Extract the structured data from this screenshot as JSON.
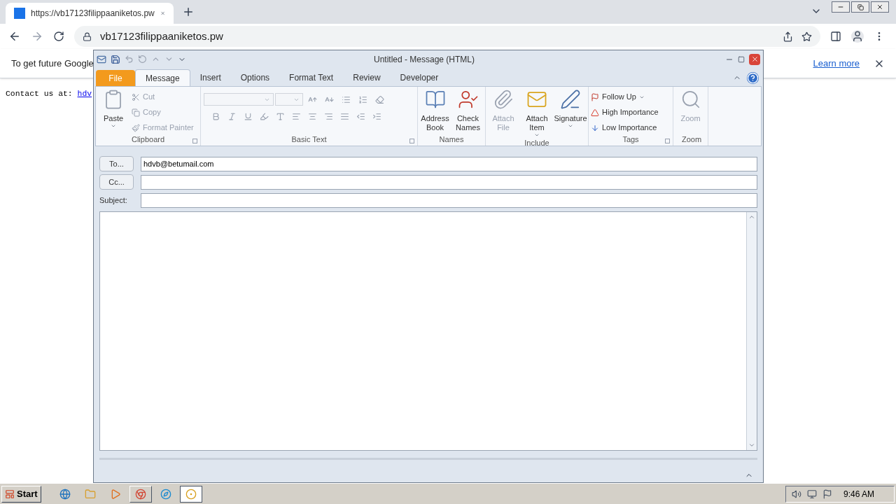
{
  "browser": {
    "tab": {
      "title": "https://vb17123filippaaniketos.pw"
    },
    "address": "vb17123filippaaniketos.pw",
    "infobar": {
      "text": "To get future Google",
      "link": "Learn more"
    }
  },
  "page": {
    "label": "Contact us at:",
    "link": "hdv"
  },
  "outlook": {
    "title": "Untitled - Message (HTML)",
    "tabs": [
      {
        "label": "File",
        "kind": "file",
        "selected": false
      },
      {
        "label": "Message",
        "kind": "tab",
        "selected": true
      },
      {
        "label": "Insert",
        "kind": "tab",
        "selected": false
      },
      {
        "label": "Options",
        "kind": "tab",
        "selected": false
      },
      {
        "label": "Format Text",
        "kind": "tab",
        "selected": false
      },
      {
        "label": "Review",
        "kind": "tab",
        "selected": false
      },
      {
        "label": "Developer",
        "kind": "tab",
        "selected": false
      }
    ],
    "groups": [
      {
        "label": "Clipboard",
        "kind": "clipboard",
        "launcher": true,
        "items": [
          {
            "label": "Paste",
            "kind": "large",
            "dropdown": true,
            "disabled": false
          },
          {
            "label": "Cut",
            "kind": "small",
            "disabled": true
          },
          {
            "label": "Copy",
            "kind": "small",
            "disabled": true
          },
          {
            "label": "Format Painter",
            "kind": "small",
            "disabled": true
          }
        ]
      },
      {
        "label": "Basic Text",
        "kind": "format",
        "launcher": true
      },
      {
        "label": "Names",
        "kind": "buttons",
        "launcher": false,
        "items": [
          {
            "label": "Address Book",
            "kind": "large",
            "dropdown": false,
            "disabled": false
          },
          {
            "label": "Check Names",
            "kind": "large",
            "dropdown": false,
            "disabled": false
          }
        ]
      },
      {
        "label": "Include",
        "kind": "buttons",
        "launcher": false,
        "items": [
          {
            "label": "Attach File",
            "kind": "large",
            "dropdown": false,
            "disabled": true
          },
          {
            "label": "Attach Item",
            "kind": "large",
            "dropdown": true,
            "disabled": false
          },
          {
            "label": "Signature",
            "kind": "large",
            "dropdown": true,
            "disabled": false
          }
        ]
      },
      {
        "label": "Tags",
        "kind": "buttons",
        "launcher": true,
        "items": [
          {
            "label": "Follow Up",
            "kind": "small",
            "dropdown": true,
            "disabled": false
          },
          {
            "label": "High Importance",
            "kind": "small",
            "dropdown": false,
            "disabled": false
          },
          {
            "label": "Low Importance",
            "kind": "small",
            "dropdown": false,
            "disabled": false
          }
        ]
      },
      {
        "label": "Zoom",
        "kind": "buttons",
        "launcher": false,
        "items": [
          {
            "label": "Zoom",
            "kind": "large",
            "dropdown": false,
            "disabled": true
          }
        ]
      }
    ],
    "fields": [
      {
        "label": "To...",
        "kind": "button",
        "value": "hdvb@betumail.com"
      },
      {
        "label": "Cc...",
        "kind": "button"
      },
      {
        "label": "Subject:",
        "kind": "label"
      }
    ]
  },
  "taskbar": {
    "start": "Start",
    "items": [
      {
        "kind": "launcher"
      },
      {
        "kind": "launcher"
      },
      {
        "kind": "launcher"
      },
      {
        "kind": "window",
        "selected": false
      },
      {
        "kind": "launcher"
      },
      {
        "kind": "window",
        "selected": true
      }
    ],
    "clock": "9:46 AM"
  }
}
